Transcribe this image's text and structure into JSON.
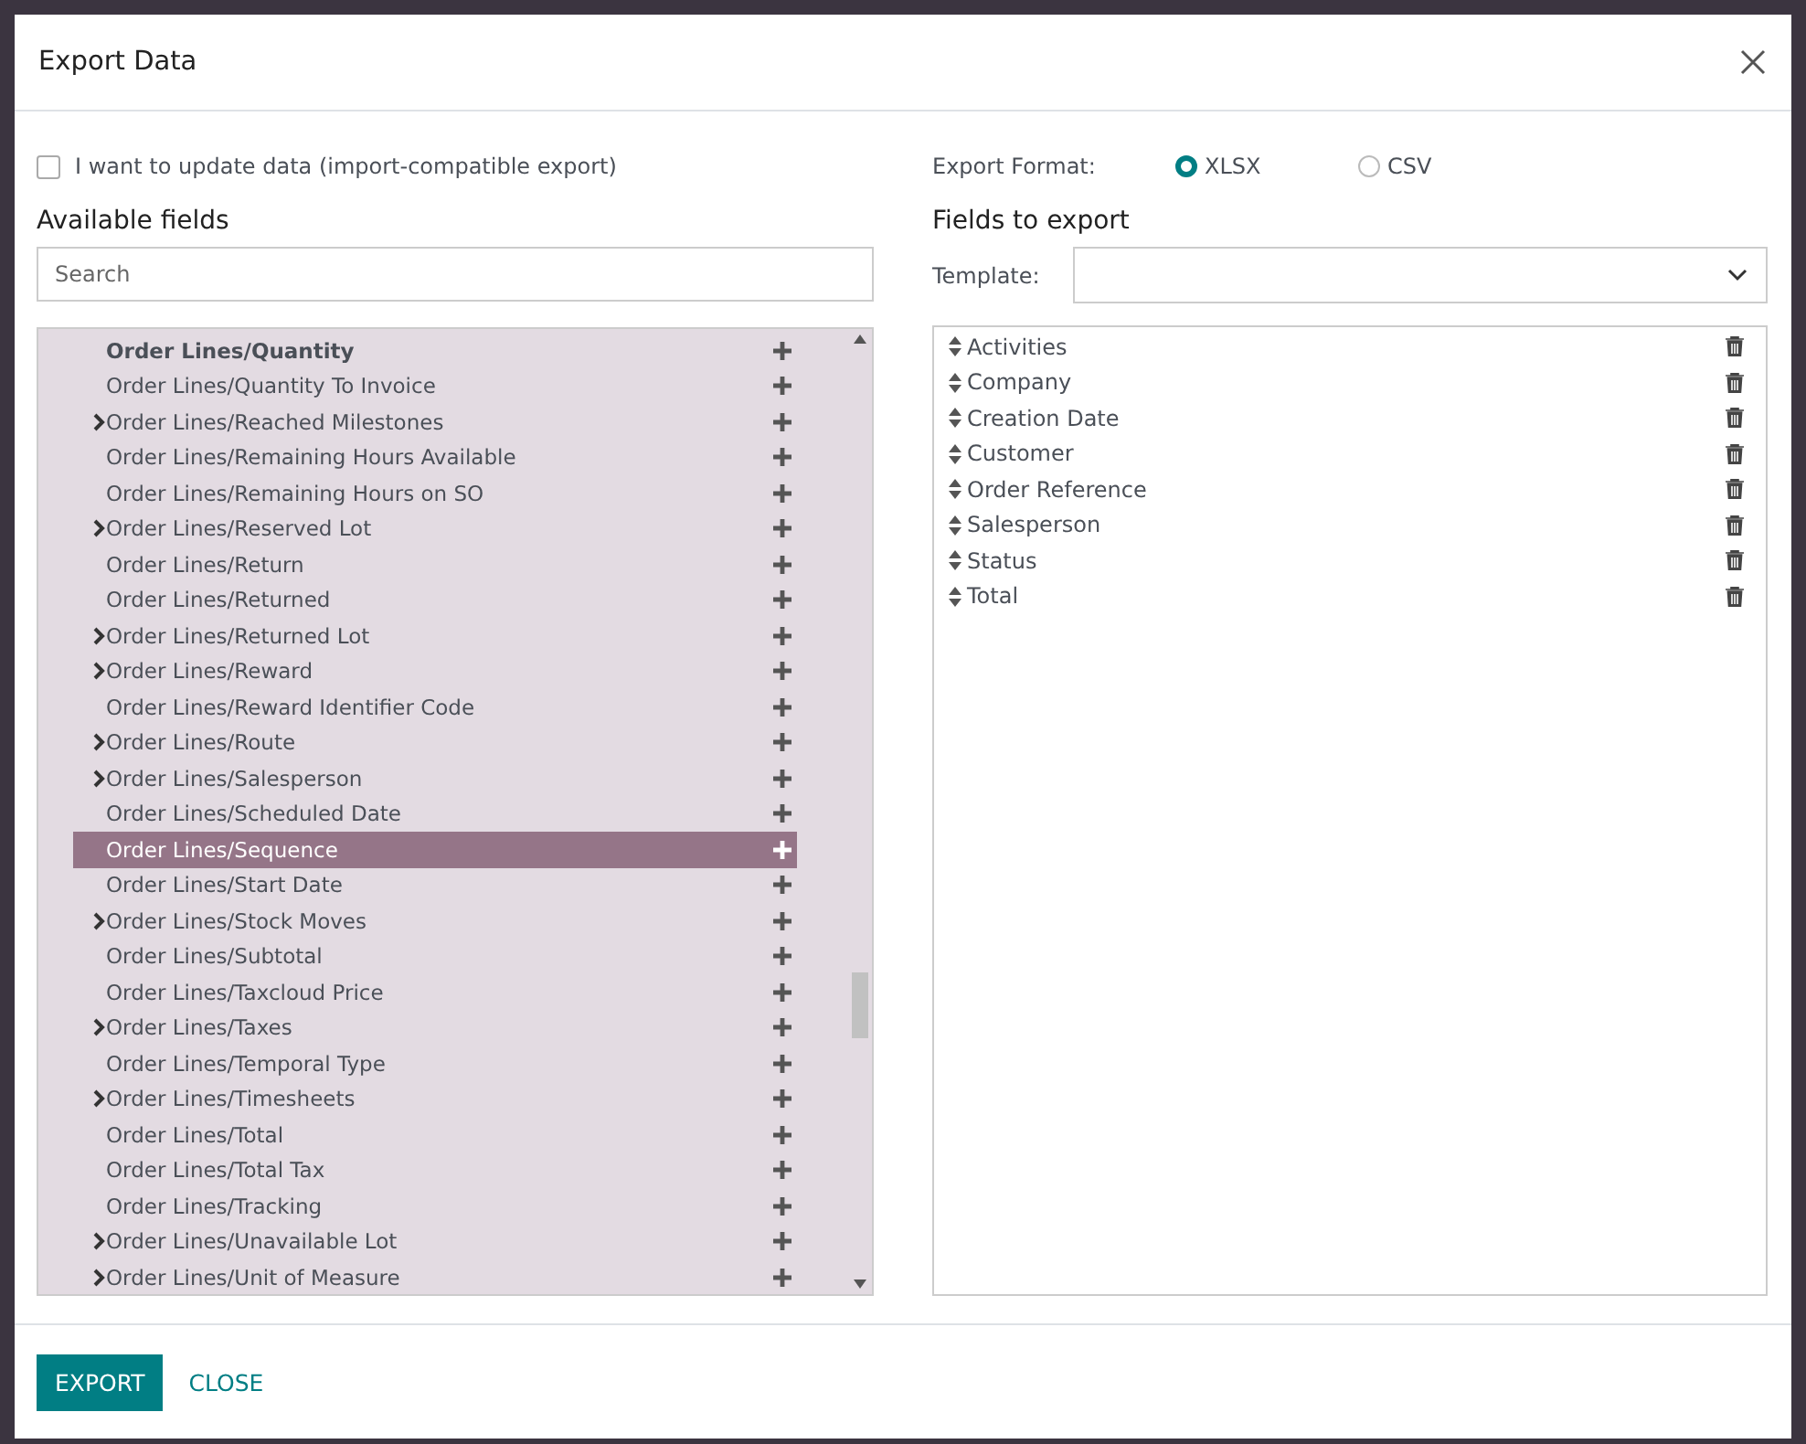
{
  "dialog": {
    "title": "Export Data"
  },
  "import_compatible": {
    "label": "I want to update data (import-compatible export)",
    "checked": false
  },
  "available_fields": {
    "heading": "Available fields",
    "search": {
      "placeholder": "Search"
    },
    "items": [
      {
        "label": "Order Lines/Quantity",
        "expandable": false,
        "emphasized": true,
        "selected": false
      },
      {
        "label": "Order Lines/Quantity To Invoice",
        "expandable": false,
        "emphasized": false,
        "selected": false
      },
      {
        "label": "Order Lines/Reached Milestones",
        "expandable": true,
        "emphasized": false,
        "selected": false
      },
      {
        "label": "Order Lines/Remaining Hours Available",
        "expandable": false,
        "emphasized": false,
        "selected": false
      },
      {
        "label": "Order Lines/Remaining Hours on SO",
        "expandable": false,
        "emphasized": false,
        "selected": false
      },
      {
        "label": "Order Lines/Reserved Lot",
        "expandable": true,
        "emphasized": false,
        "selected": false
      },
      {
        "label": "Order Lines/Return",
        "expandable": false,
        "emphasized": false,
        "selected": false
      },
      {
        "label": "Order Lines/Returned",
        "expandable": false,
        "emphasized": false,
        "selected": false
      },
      {
        "label": "Order Lines/Returned Lot",
        "expandable": true,
        "emphasized": false,
        "selected": false
      },
      {
        "label": "Order Lines/Reward",
        "expandable": true,
        "emphasized": false,
        "selected": false
      },
      {
        "label": "Order Lines/Reward Identifier Code",
        "expandable": false,
        "emphasized": false,
        "selected": false
      },
      {
        "label": "Order Lines/Route",
        "expandable": true,
        "emphasized": false,
        "selected": false
      },
      {
        "label": "Order Lines/Salesperson",
        "expandable": true,
        "emphasized": false,
        "selected": false
      },
      {
        "label": "Order Lines/Scheduled Date",
        "expandable": false,
        "emphasized": false,
        "selected": false
      },
      {
        "label": "Order Lines/Sequence",
        "expandable": false,
        "emphasized": false,
        "selected": true
      },
      {
        "label": "Order Lines/Start Date",
        "expandable": false,
        "emphasized": false,
        "selected": false
      },
      {
        "label": "Order Lines/Stock Moves",
        "expandable": true,
        "emphasized": false,
        "selected": false
      },
      {
        "label": "Order Lines/Subtotal",
        "expandable": false,
        "emphasized": false,
        "selected": false
      },
      {
        "label": "Order Lines/Taxcloud Price",
        "expandable": false,
        "emphasized": false,
        "selected": false
      },
      {
        "label": "Order Lines/Taxes",
        "expandable": true,
        "emphasized": false,
        "selected": false
      },
      {
        "label": "Order Lines/Temporal Type",
        "expandable": false,
        "emphasized": false,
        "selected": false
      },
      {
        "label": "Order Lines/Timesheets",
        "expandable": true,
        "emphasized": false,
        "selected": false
      },
      {
        "label": "Order Lines/Total",
        "expandable": false,
        "emphasized": false,
        "selected": false
      },
      {
        "label": "Order Lines/Total Tax",
        "expandable": false,
        "emphasized": false,
        "selected": false
      },
      {
        "label": "Order Lines/Tracking",
        "expandable": false,
        "emphasized": false,
        "selected": false
      },
      {
        "label": "Order Lines/Unavailable Lot",
        "expandable": true,
        "emphasized": false,
        "selected": false
      },
      {
        "label": "Order Lines/Unit of Measure",
        "expandable": true,
        "emphasized": false,
        "selected": false
      }
    ]
  },
  "export_format": {
    "label": "Export Format:",
    "options": [
      {
        "label": "XLSX",
        "selected": true
      },
      {
        "label": "CSV",
        "selected": false
      }
    ]
  },
  "fields_to_export": {
    "heading": "Fields to export",
    "template_label": "Template:",
    "items": [
      "Activities",
      "Company",
      "Creation Date",
      "Customer",
      "Order Reference",
      "Salesperson",
      "Status",
      "Total"
    ]
  },
  "buttons": [
    {
      "label": "EXPORT",
      "kind": "primary"
    },
    {
      "label": "CLOSE",
      "kind": "link"
    }
  ]
}
